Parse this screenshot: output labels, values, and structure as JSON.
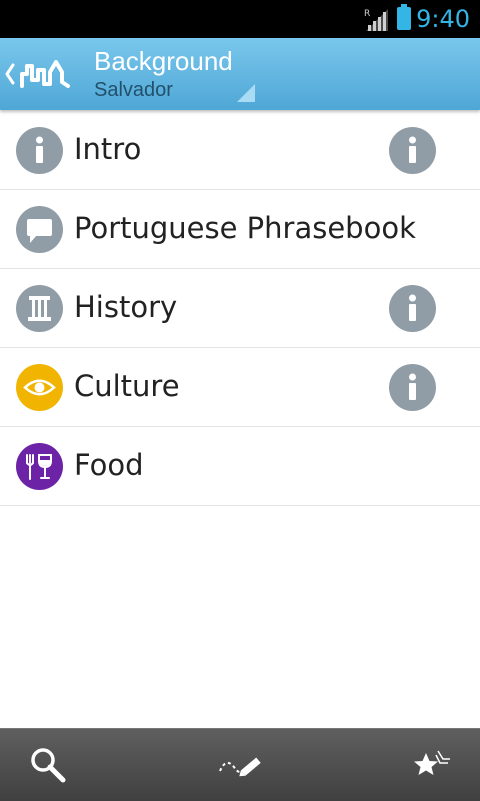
{
  "status_bar": {
    "time": "9:40",
    "roaming_indicator": "R",
    "icons": [
      "signal-icon",
      "battery-icon"
    ],
    "accent_color": "#33b5e5"
  },
  "action_bar": {
    "title": "Background",
    "subtitle": "Salvador",
    "icons": [
      "back-chevron-icon",
      "city-skyline-logo-icon",
      "spinner-triangle-icon"
    ]
  },
  "list": {
    "items": [
      {
        "label": "Intro",
        "icon": "info-icon",
        "icon_color": "#919da6",
        "has_info_button": true
      },
      {
        "label": "Portuguese Phrasebook",
        "icon": "speech-bubble-icon",
        "icon_color": "#919da6",
        "has_info_button": false
      },
      {
        "label": "History",
        "icon": "column-icon",
        "icon_color": "#919da6",
        "has_info_button": true
      },
      {
        "label": "Culture",
        "icon": "eye-icon",
        "icon_color": "#f1b400",
        "has_info_button": true
      },
      {
        "label": "Food",
        "icon": "fork-glass-icon",
        "icon_color": "#6d23a6",
        "has_info_button": false
      }
    ]
  },
  "bottom_bar": {
    "buttons": [
      "search-icon",
      "pencil-trail-icon",
      "stars-icon"
    ]
  }
}
